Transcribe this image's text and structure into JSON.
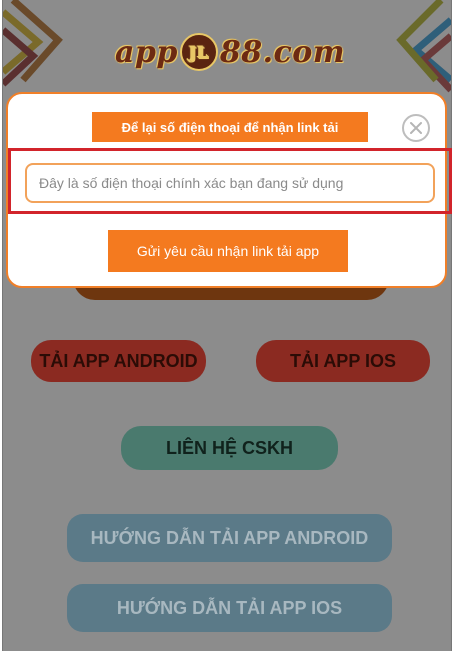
{
  "logo": {
    "text_left": "app",
    "badge": "JL",
    "text_right": "88.com"
  },
  "modal": {
    "title": "Để lại số điện thoại để nhận link tải",
    "close_icon": "close-icon",
    "phone_placeholder": "Đây là số điện thoại chính xác bạn đang sử dụng",
    "submit_label": "Gửi yêu cầu nhận link tải app"
  },
  "buttons": {
    "android": "TẢI APP ANDROID",
    "ios": "TẢI APP IOS",
    "cskh": "LIÊN HỆ CSKH",
    "guide_android": "HƯỚNG DẪN TẢI APP ANDROID",
    "guide_ios": "HƯỚNG DẪN TẢI APP IOS"
  },
  "colors": {
    "accent_orange": "#f47a1f",
    "highlight_red": "#d2242b",
    "overlay_gray": "#8c8c8c"
  }
}
